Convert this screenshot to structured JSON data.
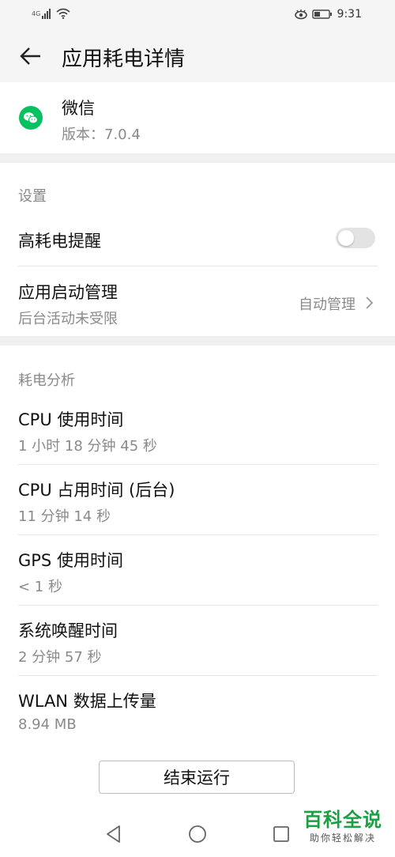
{
  "status_bar": {
    "network": "4G",
    "time": "9:31"
  },
  "header": {
    "title": "应用耗电详情",
    "back_icon": "arrow-left-icon"
  },
  "app": {
    "name": "微信",
    "version": "版本：7.0.4",
    "icon": "wechat-icon",
    "brand_color": "#07c160"
  },
  "settings": {
    "label": "设置",
    "high_power_alert": {
      "title": "高耗电提醒",
      "enabled": false
    },
    "launch_management": {
      "title": "应用启动管理",
      "subtitle": "后台活动未受限",
      "value": "自动管理"
    }
  },
  "analysis": {
    "label": "耗电分析",
    "items": [
      {
        "title": "CPU 使用时间",
        "value": "1 小时 18 分钟 45 秒"
      },
      {
        "title": "CPU 占用时间 (后台)",
        "value": "11 分钟 14 秒"
      },
      {
        "title": "GPS 使用时间",
        "value": "< 1 秒"
      },
      {
        "title": "系统唤醒时间",
        "value": "2 分钟 57 秒"
      },
      {
        "title": "WLAN 数据上传量",
        "value": "8.94 MB"
      }
    ]
  },
  "actions": {
    "end_label": "结束运行"
  },
  "watermark": {
    "title": "百科全说",
    "subtitle": "助你轻松解决"
  },
  "colors": {
    "background_gray": "#f5f5f5",
    "secondary_text": "#8a8a8a",
    "watermark_green": "#1aa043"
  }
}
